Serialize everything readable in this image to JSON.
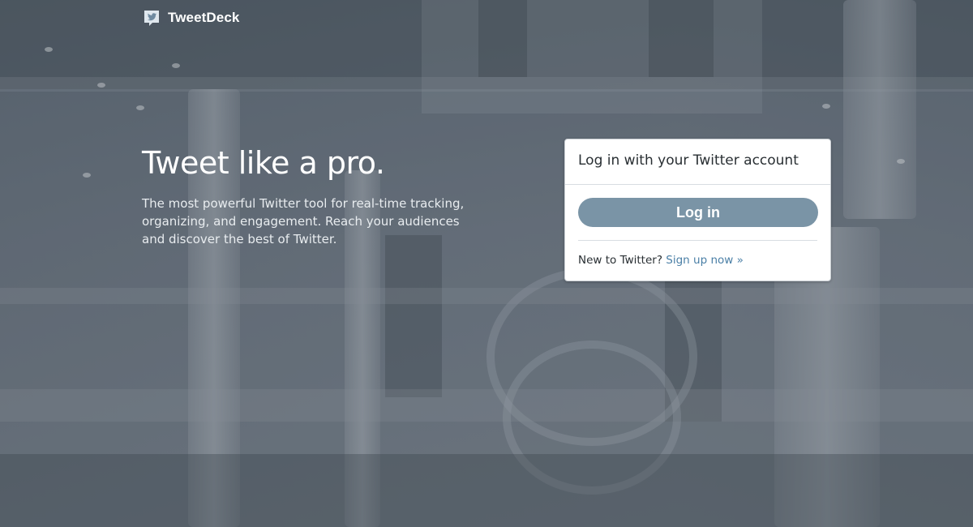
{
  "header": {
    "brand_name": "TweetDeck",
    "brand_icon": "twitter-bird-icon"
  },
  "hero": {
    "title": "Tweet like a pro.",
    "description": "The most powerful Twitter tool for real-time tracking, organizing, and engagement. Reach your audiences and discover the best of Twitter."
  },
  "login_card": {
    "heading": "Log in with your Twitter account",
    "login_label": "Log in",
    "new_user_text": "New to Twitter?",
    "signup_link": "Sign up now »"
  },
  "colors": {
    "login_button": "#7a94a6",
    "link": "#4a7fa6",
    "card_background": "#ffffff"
  }
}
